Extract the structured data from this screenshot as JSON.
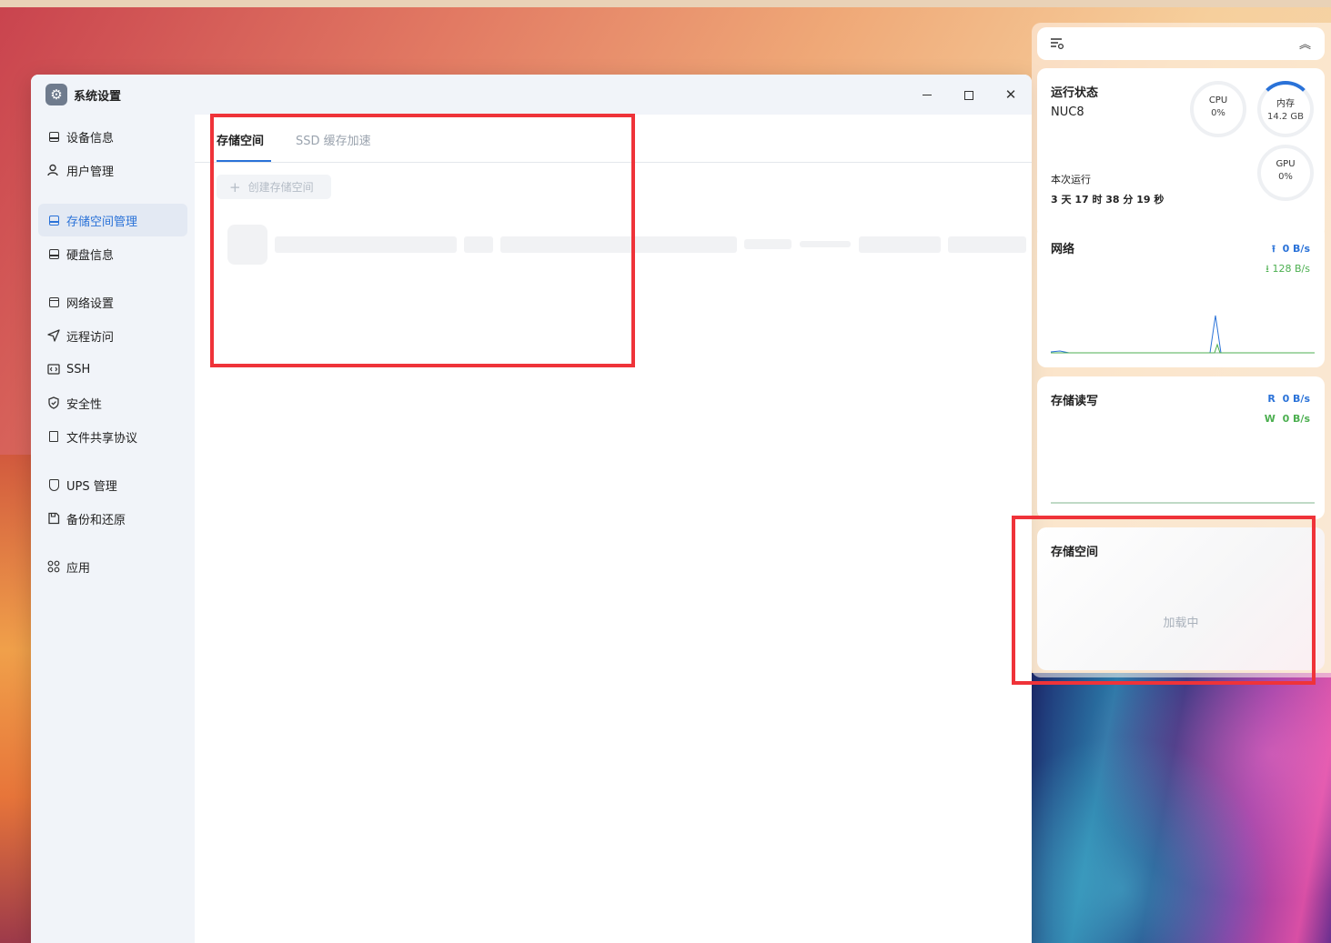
{
  "window": {
    "title": "系统设置",
    "icon": "gear-icon"
  },
  "sidebar": {
    "items": [
      {
        "label": "设备信息",
        "icon": "device-icon"
      },
      {
        "label": "用户管理",
        "icon": "user-icon"
      },
      {
        "label": "存储空间管理",
        "icon": "storage-icon",
        "active": true
      },
      {
        "label": "硬盘信息",
        "icon": "disk-icon"
      },
      {
        "label": "网络设置",
        "icon": "network-icon"
      },
      {
        "label": "远程访问",
        "icon": "send-icon"
      },
      {
        "label": "SSH",
        "icon": "code-icon"
      },
      {
        "label": "安全性",
        "icon": "shield-icon"
      },
      {
        "label": "文件共享协议",
        "icon": "document-icon"
      },
      {
        "label": "UPS 管理",
        "icon": "battery-shield-icon"
      },
      {
        "label": "备份和还原",
        "icon": "save-icon"
      },
      {
        "label": "应用",
        "icon": "apps-grid-icon"
      }
    ]
  },
  "main": {
    "tabs": [
      {
        "label": "存储空间",
        "active": true
      },
      {
        "label": "SSD 缓存加速"
      }
    ],
    "create_button": "创建存储空间"
  },
  "widgets": {
    "status": {
      "title": "运行状态",
      "device": "NUC8",
      "cpu_label": "CPU",
      "cpu_value": "0%",
      "mem_label": "内存",
      "mem_value": "14.2 GB",
      "gpu_label": "GPU",
      "gpu_value": "0%",
      "uptime_label": "本次运行",
      "uptime_value": "3 天 17 时 38 分 19 秒"
    },
    "network": {
      "title": "网络",
      "upload": "0 B/s",
      "download": "128 B/s"
    },
    "disk_io": {
      "title": "存储读写",
      "read_prefix": "R",
      "read": "0 B/s",
      "write_prefix": "W",
      "write": "0 B/s"
    },
    "storage": {
      "title": "存储空间",
      "loading": "加载中"
    }
  },
  "colors": {
    "accent": "#2a72d8",
    "upload": "#2a72d8",
    "download": "#4caf50",
    "highlight": "#ef3339"
  }
}
